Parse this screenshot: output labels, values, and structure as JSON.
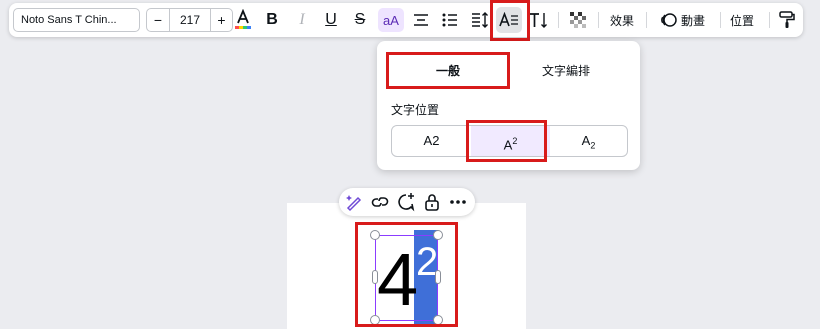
{
  "toolbar": {
    "font_family": "Noto Sans T Chin...",
    "font_size": "217",
    "minus_label": "−",
    "plus_label": "+",
    "bold_label": "B",
    "italic_label": "I",
    "underline_label": "U",
    "strike_label": "S",
    "case_label": "aA",
    "effects_label": "效果",
    "animate_label": "動畫",
    "position_label": "位置"
  },
  "popup": {
    "tab_general": "一般",
    "tab_typesetting": "文字編排",
    "section_label": "文字位置",
    "options": {
      "normal": "A2",
      "superscript_base": "A",
      "superscript_mark": "2",
      "subscript_base": "A",
      "subscript_mark": "2"
    }
  },
  "canvas": {
    "text_main": "4",
    "text_superscript": "2"
  },
  "colors": {
    "accent_purple": "#8b3dff",
    "highlight_blue": "#3f6fd8",
    "annotation_red": "#d81b1b"
  }
}
